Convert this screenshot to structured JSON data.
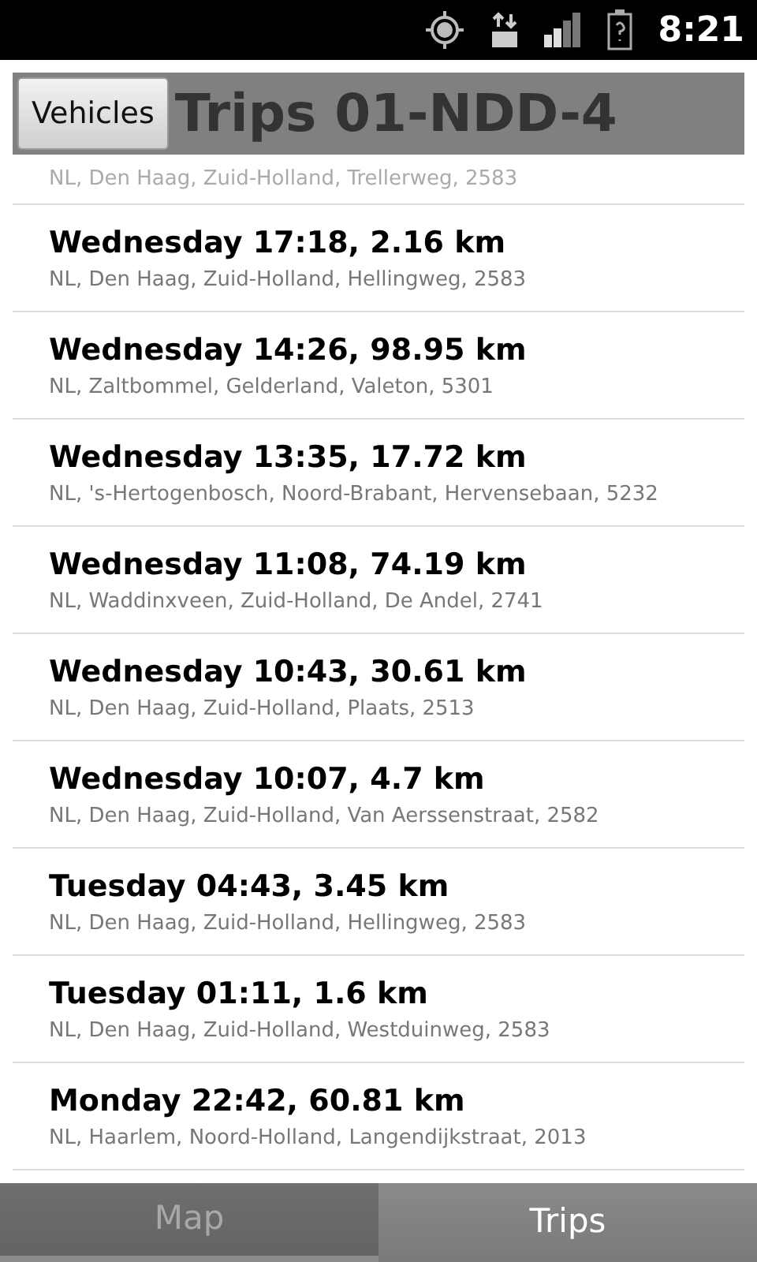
{
  "status_bar": {
    "time": "8:21"
  },
  "header": {
    "back_button": "Vehicles",
    "title": "Trips 01-NDD-4"
  },
  "partial_trip": {
    "address": "NL, Den Haag, Zuid-Holland, Trellerweg, 2583"
  },
  "trips": [
    {
      "title": "Wednesday 17:18, 2.16 km",
      "address": "NL, Den Haag, Zuid-Holland, Hellingweg, 2583"
    },
    {
      "title": "Wednesday 14:26, 98.95 km",
      "address": "NL, Zaltbommel, Gelderland, Valeton, 5301"
    },
    {
      "title": "Wednesday 13:35, 17.72 km",
      "address": "NL, 's-Hertogenbosch, Noord-Brabant, Hervensebaan, 5232"
    },
    {
      "title": "Wednesday 11:08, 74.19 km",
      "address": "NL, Waddinxveen, Zuid-Holland, De Andel, 2741"
    },
    {
      "title": "Wednesday 10:43, 30.61 km",
      "address": "NL, Den Haag, Zuid-Holland, Plaats, 2513"
    },
    {
      "title": "Wednesday 10:07, 4.7 km",
      "address": "NL, Den Haag, Zuid-Holland, Van Aerssenstraat, 2582"
    },
    {
      "title": "Tuesday 04:43, 3.45 km",
      "address": "NL, Den Haag, Zuid-Holland, Hellingweg, 2583"
    },
    {
      "title": "Tuesday 01:11, 1.6 km",
      "address": "NL, Den Haag, Zuid-Holland, Westduinweg, 2583"
    },
    {
      "title": "Monday 22:42, 60.81 km",
      "address": "NL, Haarlem, Noord-Holland, Langendijkstraat, 2013"
    }
  ],
  "tabs": [
    {
      "label": "Map",
      "selected": false
    },
    {
      "label": "Trips",
      "selected": true
    }
  ]
}
